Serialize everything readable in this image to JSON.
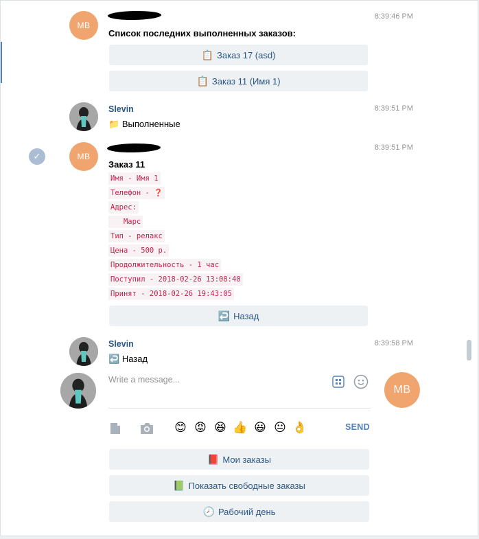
{
  "messages": {
    "m1": {
      "avatar_initials": "MB",
      "time": "8:39:46 PM",
      "text": "Список последних выполненных заказов:",
      "buttons": [
        {
          "emoji": "📋",
          "label": "Заказ 17 (asd)"
        },
        {
          "emoji": "📋",
          "label": "Заказ 11 (Имя 1)"
        }
      ]
    },
    "m2": {
      "author": "Slevin",
      "time": "8:39:51 PM",
      "emoji": "📁",
      "text": "Выполненные"
    },
    "m3": {
      "avatar_initials": "MB",
      "time": "8:39:51 PM",
      "title": "Заказ 11",
      "lines": [
        "Имя - Имя 1",
        "Телефон - ❓",
        "Адрес:",
        "   Марс",
        "Тип - релакс",
        "Цена - 500 р.",
        "Продолжительность - 1 час",
        "Поступил - 2018-02-26 13:08:40",
        "Принят - 2018-02-26 19:43:05"
      ],
      "button": {
        "emoji": "↩️",
        "label": "Назад"
      }
    },
    "m4": {
      "author": "Slevin",
      "time": "8:39:58 PM",
      "emoji": "↩️",
      "text": "Назад"
    }
  },
  "composer": {
    "placeholder": "Write a message...",
    "send_label": "SEND",
    "right_avatar_initials": "MB",
    "emojis": [
      "😊",
      "😡",
      "😆",
      "👍",
      "😃",
      "😐",
      "👌"
    ]
  },
  "keyboard": [
    {
      "emoji": "📕",
      "label": "Мои заказы"
    },
    {
      "emoji": "📗",
      "label": "Показать свободные заказы"
    },
    {
      "emoji": "🕗",
      "label": "Рабочий день"
    }
  ],
  "colors": {
    "accent": "#5181b8",
    "link": "#2a5885",
    "avatar_bg": "#f0a56e",
    "code_text": "#c7254e",
    "code_bg": "#f9f2f4"
  }
}
